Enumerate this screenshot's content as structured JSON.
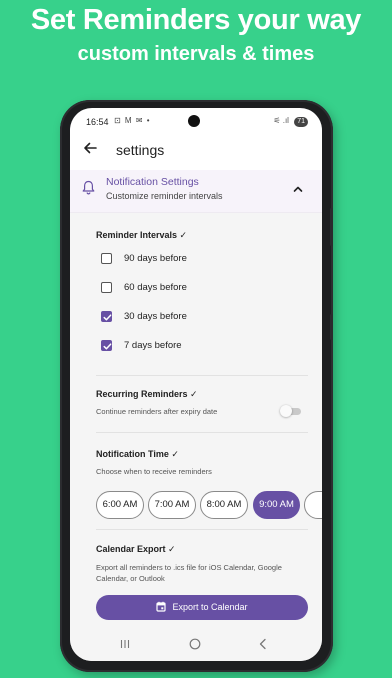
{
  "promo": {
    "title": "Set Reminders your way",
    "subtitle": "custom intervals & times",
    "background_color": "#37d18b"
  },
  "status_bar": {
    "time": "16:54",
    "left_icons": "⊡ M ✉ •",
    "right_icons": "⚟ .ıl",
    "battery": "71"
  },
  "app_bar": {
    "back_icon": "arrow-left-icon",
    "title": "settings"
  },
  "notification_settings": {
    "icon": "bell-icon",
    "title": "Notification Settings",
    "subtitle": "Customize reminder intervals",
    "expanded": true
  },
  "reminder_intervals": {
    "heading": "Reminder Intervals ✓",
    "options": [
      {
        "label": "90 days before",
        "checked": false
      },
      {
        "label": "60 days before",
        "checked": false
      },
      {
        "label": "30 days before",
        "checked": true
      },
      {
        "label": "7 days before",
        "checked": true
      }
    ]
  },
  "recurring": {
    "heading": "Recurring Reminders ✓",
    "description": "Continue reminders after expiry date",
    "enabled": false
  },
  "notification_time": {
    "heading": "Notification Time ✓",
    "description": "Choose when to receive reminders",
    "options": [
      "6:00 AM",
      "7:00 AM",
      "8:00 AM",
      "9:00 AM"
    ],
    "selected": "9:00 AM"
  },
  "calendar_export": {
    "heading": "Calendar Export ✓",
    "description": "Export all reminders to .ics file for iOS Calendar, Google Calendar, or Outlook",
    "button_label": "Export to Calendar",
    "button_icon": "calendar-icon"
  },
  "colors": {
    "accent": "#6750a4",
    "section_background": "#f7f3fa"
  },
  "nav_bar": {
    "icons": [
      "recents-icon",
      "home-icon",
      "back-icon"
    ]
  }
}
